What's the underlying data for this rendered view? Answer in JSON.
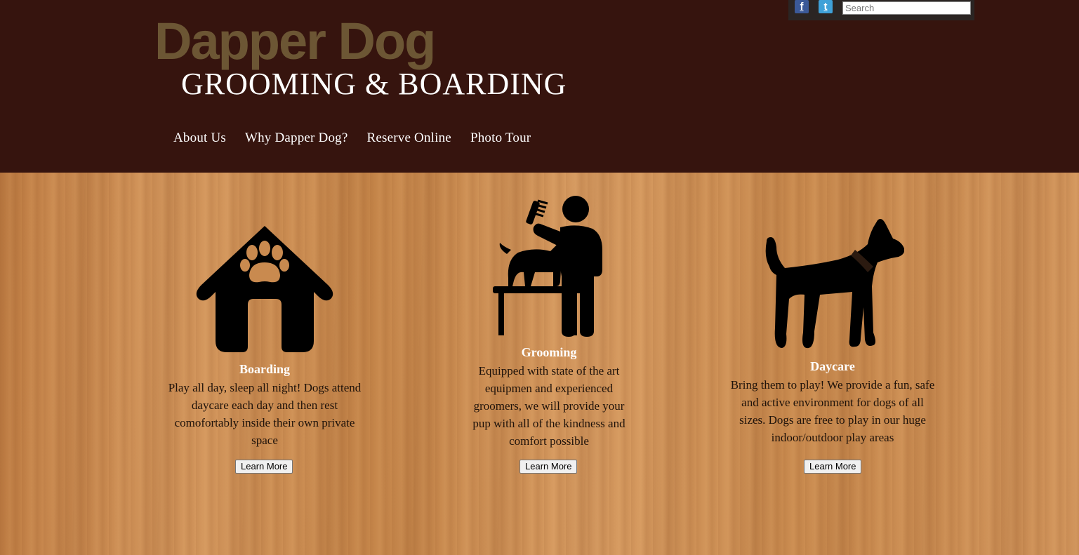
{
  "brand": {
    "name": "Dapper Dog",
    "tagline": "GROOMING & BOARDING"
  },
  "social": {
    "facebook_glyph": "f",
    "twitter_glyph": "t"
  },
  "search": {
    "placeholder": "Search"
  },
  "nav": [
    {
      "label": "About Us"
    },
    {
      "label": "Why Dapper Dog?"
    },
    {
      "label": "Reserve Online"
    },
    {
      "label": "Photo Tour"
    }
  ],
  "services": [
    {
      "title": "Boarding",
      "text": "Play all day, sleep all night! Dogs attend daycare each day and then rest comofortably inside their own private space",
      "button": "Learn More",
      "icon": "dog-house-paw-icon"
    },
    {
      "title": "Grooming",
      "text": "Equipped with state of the art equipmen and experienced groomers, we will provide your pup with all of the kindness and comfort possible",
      "button": "Learn More",
      "icon": "groomer-icon"
    },
    {
      "title": "Daycare",
      "text": "Bring them to play! We provide a fun, safe and active environment for dogs of all sizes. Dogs are free to play in our huge indoor/outdoor play areas",
      "button": "Learn More",
      "icon": "dog-icon"
    }
  ],
  "colors": {
    "header_bg": "#36140e",
    "brand_main": "#6c5634",
    "facebook": "#3b5998",
    "twitter": "#3fa1d8"
  }
}
